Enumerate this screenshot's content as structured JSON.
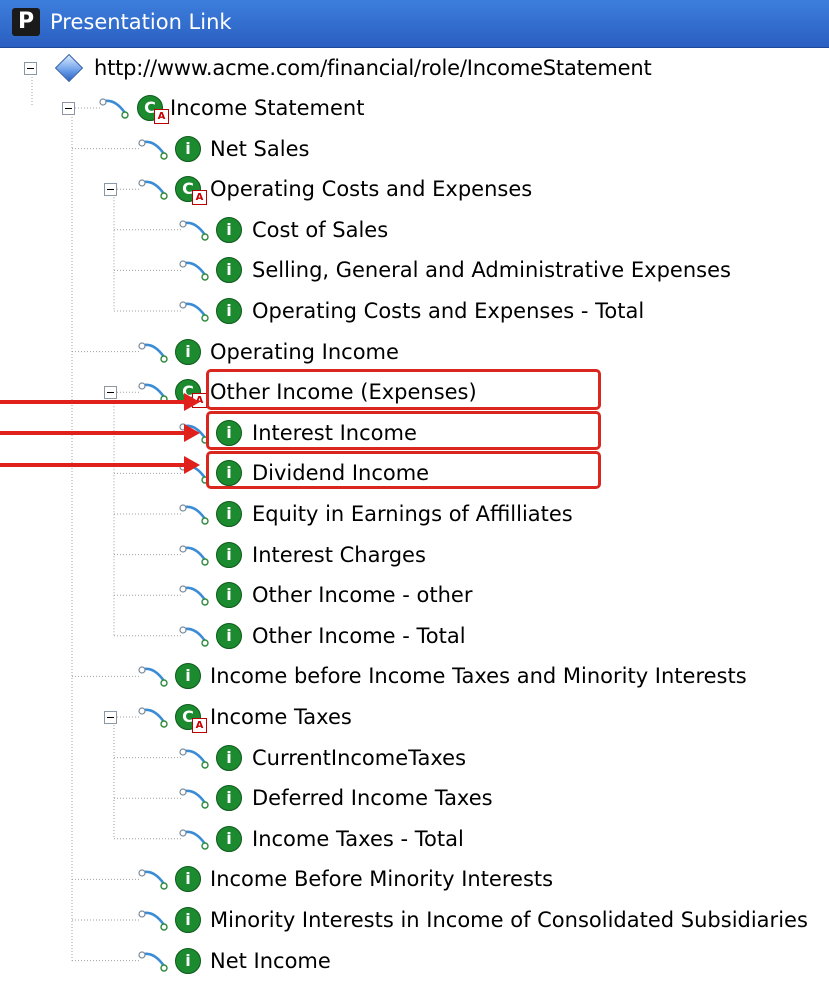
{
  "window": {
    "title": "Presentation Link",
    "title_icon_letter": "P"
  },
  "tree": {
    "root": {
      "label": "http://www.acme.com/financial/role/IncomeStatement",
      "icon": "diamond-icon"
    },
    "nodes": [
      {
        "label": "Income Statement",
        "icon": "abstract-element-icon",
        "expanded": true
      },
      {
        "label": "Net Sales",
        "icon": "item-element-icon"
      },
      {
        "label": "Operating Costs and Expenses",
        "icon": "abstract-element-icon",
        "expanded": true
      },
      {
        "label": "Cost of Sales",
        "icon": "item-element-icon"
      },
      {
        "label": "Selling, General and Administrative Expenses",
        "icon": "item-element-icon"
      },
      {
        "label": "Operating Costs and Expenses - Total",
        "icon": "item-element-icon"
      },
      {
        "label": "Operating Income",
        "icon": "item-element-icon"
      },
      {
        "label": "Other Income (Expenses)",
        "icon": "abstract-element-icon",
        "expanded": true,
        "highlighted": true
      },
      {
        "label": "Interest Income",
        "icon": "item-element-icon",
        "highlighted": true
      },
      {
        "label": "Dividend Income",
        "icon": "item-element-icon",
        "highlighted": true
      },
      {
        "label": "Equity in Earnings of Affilliates",
        "icon": "item-element-icon"
      },
      {
        "label": "Interest Charges",
        "icon": "item-element-icon"
      },
      {
        "label": "Other Income - other",
        "icon": "item-element-icon"
      },
      {
        "label": "Other Income - Total",
        "icon": "item-element-icon"
      },
      {
        "label": "Income before Income Taxes and Minority Interests",
        "icon": "item-element-icon"
      },
      {
        "label": "Income Taxes",
        "icon": "abstract-element-icon",
        "expanded": true
      },
      {
        "label": "CurrentIncomeTaxes",
        "icon": "item-element-icon"
      },
      {
        "label": "Deferred Income Taxes",
        "icon": "item-element-icon"
      },
      {
        "label": "Income Taxes - Total",
        "icon": "item-element-icon"
      },
      {
        "label": "Income Before Minority Interests",
        "icon": "item-element-icon"
      },
      {
        "label": "Minority Interests in Income of Consolidated Subsidiaries",
        "icon": "item-element-icon"
      },
      {
        "label": "Net Income",
        "icon": "item-element-icon"
      }
    ]
  },
  "colors": {
    "titlebar": "#2f6bd0",
    "item_icon": "#1c8a2e",
    "highlight": "#d9271f"
  }
}
